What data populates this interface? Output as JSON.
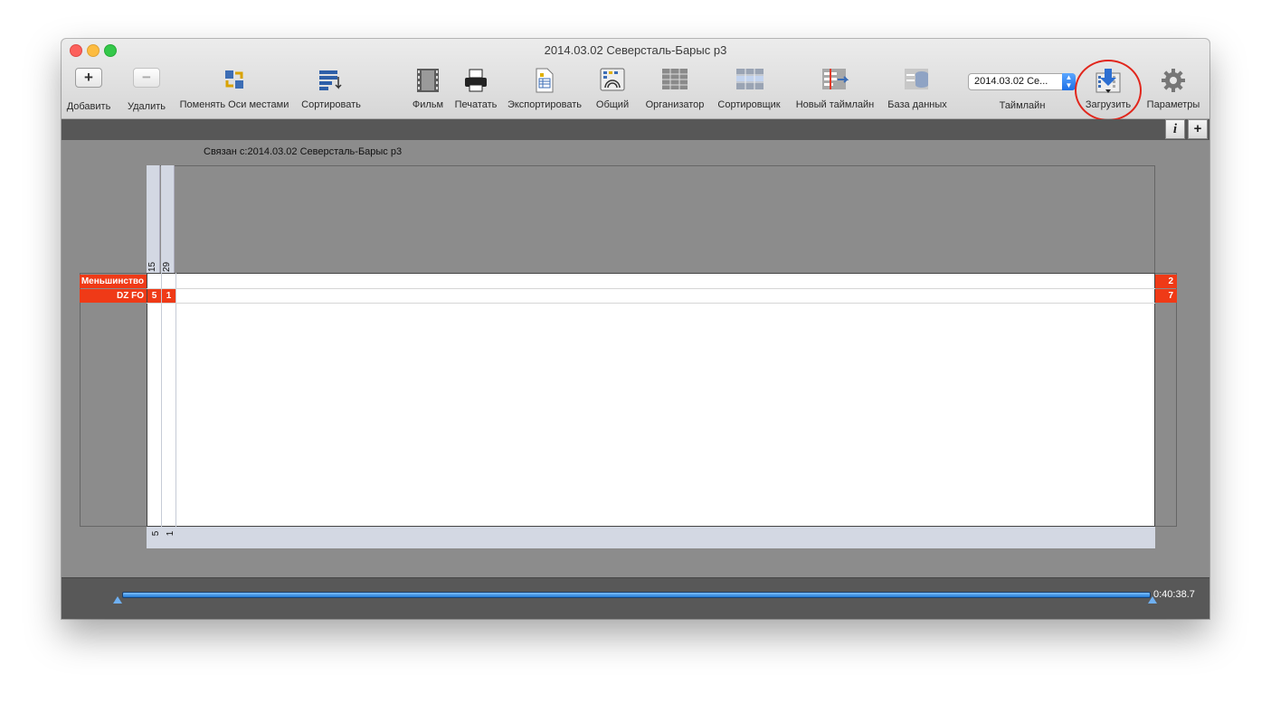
{
  "window": {
    "title": "2014.03.02 Северсталь-Барыс р3"
  },
  "toolbar": {
    "add": "Добавить",
    "remove": "Удалить",
    "swap_axes": "Поменять Оси местами",
    "sort": "Сортировать",
    "film": "Фильм",
    "print": "Печатать",
    "export": "Экспортировать",
    "general": "Общий",
    "organizer": "Организатор",
    "sorter": "Сортировщик",
    "new_timeline": "Новый таймлайн",
    "database": "База данных",
    "timeline_label": "Таймлайн",
    "timeline_value": "2014.03.02 Се...",
    "load": "Загрузить",
    "settings": "Параметры"
  },
  "subbar": {
    "info": "i",
    "plus": "+"
  },
  "matrix": {
    "linked_to": "Связан с:2014.03.02 Северсталь-Барыс р3",
    "columns": [
      "15",
      "29"
    ],
    "rows": [
      {
        "label": "Меньшинство",
        "cells": [
          "",
          ""
        ],
        "total": "2"
      },
      {
        "label": "DZ FO",
        "cells": [
          "5",
          "1"
        ],
        "total": "7"
      }
    ],
    "footer": [
      "5",
      "1"
    ]
  },
  "timeline": {
    "time": "0:40:38.7"
  },
  "colors": {
    "accent_red": "#ef3a17",
    "header_blue": "#d3d8e3",
    "track_blue": "#1f78d1"
  }
}
